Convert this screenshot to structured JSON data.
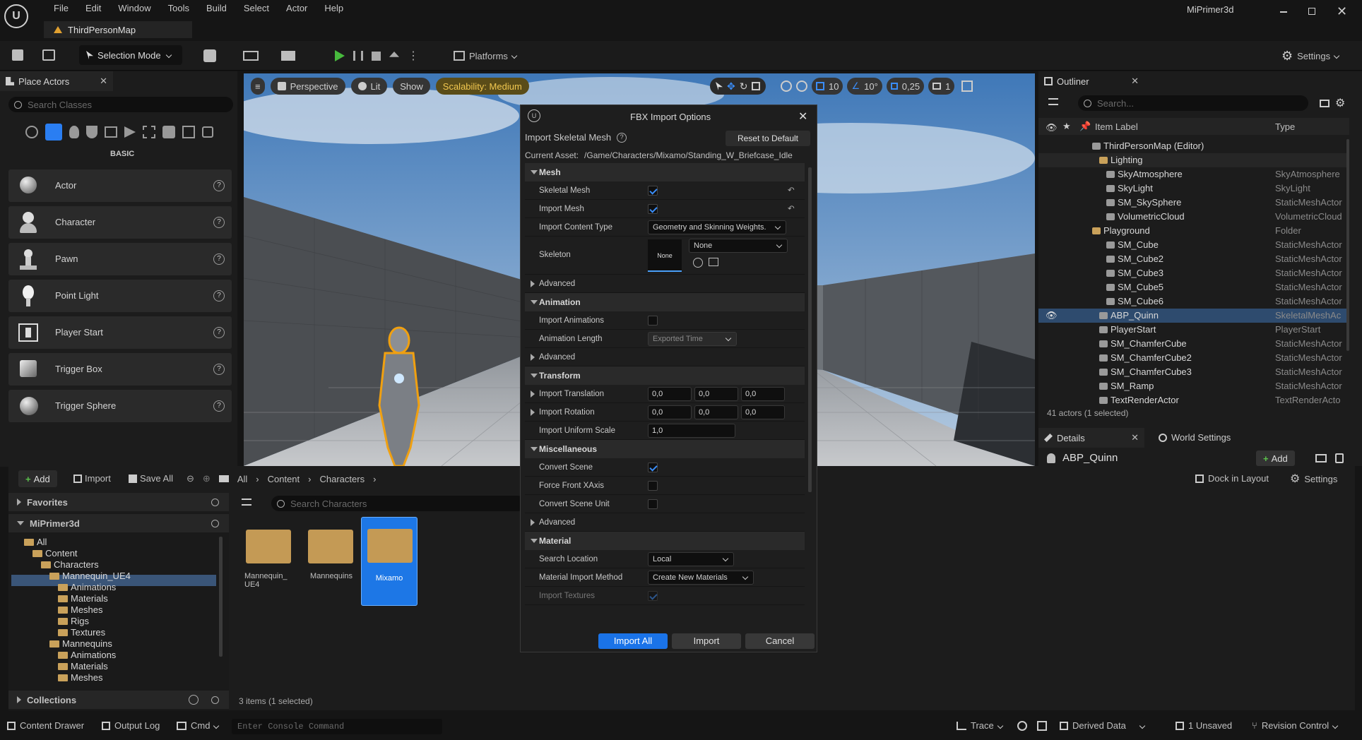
{
  "app": {
    "project": "MiPrimer3d",
    "map_tab": "ThirdPersonMap"
  },
  "menu": [
    "File",
    "Edit",
    "Window",
    "Tools",
    "Build",
    "Select",
    "Actor",
    "Help"
  ],
  "toolbar": {
    "mode": "Selection Mode",
    "platforms": "Platforms",
    "settings": "Settings"
  },
  "place_actors": {
    "tab": "Place Actors",
    "search_placeholder": "Search Classes",
    "category": "BASIC",
    "items": [
      "Actor",
      "Character",
      "Pawn",
      "Point Light",
      "Player Start",
      "Trigger Box",
      "Trigger Sphere"
    ],
    "help": "?"
  },
  "viewport": {
    "perspective": "Perspective",
    "lit": "Lit",
    "show": "Show",
    "scalability": "Scalability: Medium",
    "grid": "10",
    "angle": "10°",
    "scale": "0,25",
    "cams": "1"
  },
  "outliner": {
    "tab": "Outliner",
    "search_placeholder": "Search...",
    "col_label": "Item Label",
    "col_type": "Type",
    "rows": [
      {
        "name": "ThirdPersonMap (Editor)",
        "type": ""
      },
      {
        "name": "Lighting",
        "type": ""
      },
      {
        "name": "SkyAtmosphere",
        "type": "SkyAtmosphere"
      },
      {
        "name": "SkyLight",
        "type": "SkyLight"
      },
      {
        "name": "SM_SkySphere",
        "type": "StaticMeshActor"
      },
      {
        "name": "VolumetricCloud",
        "type": "VolumetricCloud"
      },
      {
        "name": "Playground",
        "type": "Folder"
      },
      {
        "name": "SM_Cube",
        "type": "StaticMeshActor"
      },
      {
        "name": "SM_Cube2",
        "type": "StaticMeshActor"
      },
      {
        "name": "SM_Cube3",
        "type": "StaticMeshActor"
      },
      {
        "name": "SM_Cube5",
        "type": "StaticMeshActor"
      },
      {
        "name": "SM_Cube6",
        "type": "StaticMeshActor"
      },
      {
        "name": "ABP_Quinn",
        "type": "SkeletalMeshAc"
      },
      {
        "name": "PlayerStart",
        "type": "PlayerStart"
      },
      {
        "name": "SM_ChamferCube",
        "type": "StaticMeshActor"
      },
      {
        "name": "SM_ChamferCube2",
        "type": "StaticMeshActor"
      },
      {
        "name": "SM_ChamferCube3",
        "type": "StaticMeshActor"
      },
      {
        "name": "SM_Ramp",
        "type": "StaticMeshActor"
      },
      {
        "name": "TextRenderActor",
        "type": "TextRenderActo"
      }
    ],
    "count": "41 actors (1 selected)"
  },
  "details": {
    "tab": "Details",
    "world_tab": "World Settings",
    "actor": "ABP_Quinn",
    "add": "Add"
  },
  "content": {
    "add": "Add",
    "import": "Import",
    "save_all": "Save All",
    "crumbs": [
      "All",
      "Content",
      "Characters"
    ],
    "dock": "Dock in Layout",
    "settings": "Settings",
    "favorites": "Favorites",
    "project": "MiPrimer3d",
    "tree": [
      "All",
      "Content",
      "Characters",
      "Mannequin_UE4",
      "Animations",
      "Materials",
      "Meshes",
      "Rigs",
      "Textures",
      "Mannequins",
      "Animations",
      "Materials",
      "Meshes"
    ],
    "collections": "Collections",
    "search_placeholder": "Search Characters",
    "folders": [
      "Mannequin_\nUE4",
      "Mannequins",
      "Mixamo"
    ],
    "count": "3 items (1 selected)"
  },
  "statusbar": {
    "drawer": "Content Drawer",
    "log": "Output Log",
    "cmd": "Cmd",
    "console_placeholder": "Enter Console Command",
    "trace": "Trace",
    "derived": "Derived Data",
    "unsaved": "1 Unsaved",
    "revision": "Revision Control"
  },
  "dialog": {
    "title": "FBX Import Options",
    "subtitle": "Import Skeletal Mesh",
    "reset": "Reset to Default",
    "asset_label": "Current Asset:",
    "asset_path": "/Game/Characters/Mixamo/Standing_W_Briefcase_Idle",
    "sections": {
      "mesh": "Mesh",
      "animation": "Animation",
      "transform": "Transform",
      "misc": "Miscellaneous",
      "material": "Material"
    },
    "rows": {
      "skeletal_mesh": "Skeletal Mesh",
      "import_mesh": "Import Mesh",
      "content_type": "Import Content Type",
      "content_type_val": "Geometry and Skinning Weights.",
      "skeleton": "Skeleton",
      "skeleton_thumb": "None",
      "skeleton_val": "None",
      "advanced": "Advanced",
      "import_anims": "Import Animations",
      "anim_length": "Animation Length",
      "anim_length_val": "Exported Time",
      "translation": "Import Translation",
      "rotation": "Import Rotation",
      "uniform_scale": "Import Uniform Scale",
      "zero": "0,0",
      "one": "1,0",
      "convert_scene": "Convert Scene",
      "force_front": "Force Front XAxis",
      "convert_unit": "Convert Scene Unit",
      "search_location": "Search Location",
      "search_location_val": "Local",
      "mat_method": "Material Import Method",
      "mat_method_val": "Create New Materials",
      "import_textures": "Import Textures"
    },
    "buttons": {
      "import_all": "Import All",
      "import": "Import",
      "cancel": "Cancel"
    }
  }
}
